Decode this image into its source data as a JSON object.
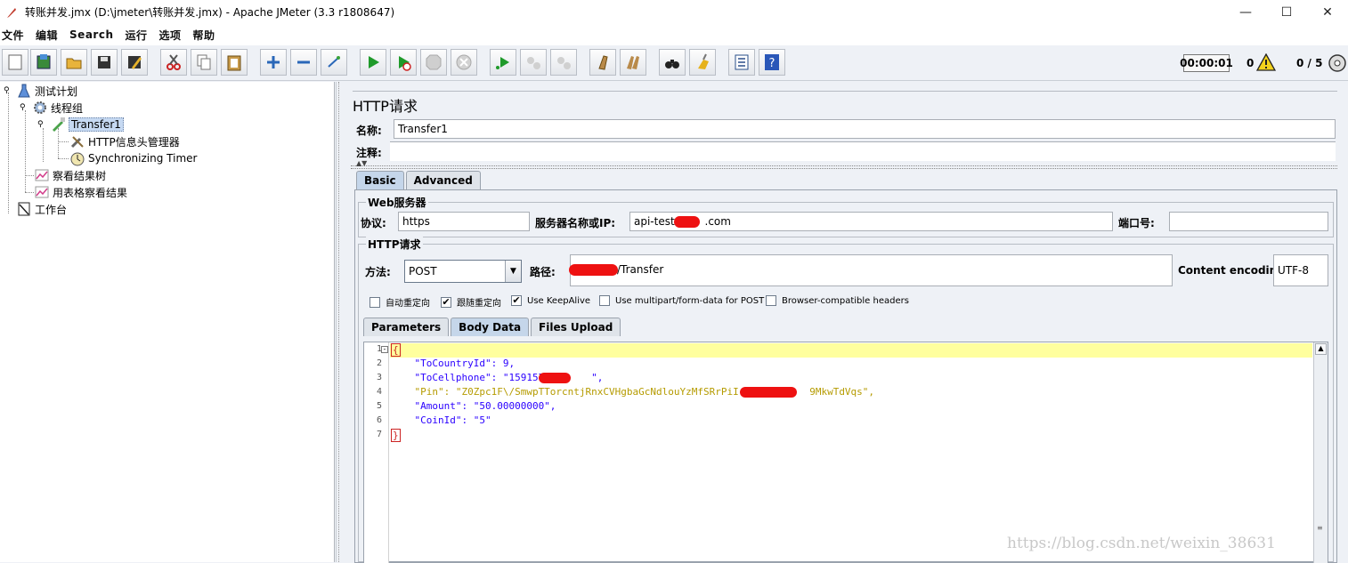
{
  "window": {
    "title": "转账并发.jmx (D:\\jmeter\\转账并发.jmx) - Apache JMeter (3.3 r1808647)",
    "minimize": "—",
    "maximize": "☐",
    "close": "✕"
  },
  "menu": [
    "文件",
    "编辑",
    "Search",
    "运行",
    "选项",
    "帮助"
  ],
  "status": {
    "timer": "00:00:01",
    "errors": "0",
    "threads": "0 / 5"
  },
  "tree": {
    "items": [
      {
        "label": "测试计划",
        "icon": "beaker-icon"
      },
      {
        "label": "线程组",
        "icon": "gear-icon"
      },
      {
        "label": "Transfer1",
        "icon": "pipette-icon"
      },
      {
        "label": "HTTP信息头管理器",
        "icon": "wrench-icon"
      },
      {
        "label": "Synchronizing Timer",
        "icon": "stopwatch-icon"
      },
      {
        "label": "察看结果树",
        "icon": "chart-icon"
      },
      {
        "label": "用表格察看结果",
        "icon": "chart-icon"
      },
      {
        "label": "工作台",
        "icon": "workbench-icon"
      }
    ]
  },
  "panel": {
    "title": "HTTP请求",
    "name_label": "名称:",
    "name_value": "Transfer1",
    "comment_label": "注释:",
    "comment_value": "",
    "tabs": [
      "Basic",
      "Advanced"
    ],
    "web_server": {
      "legend": "Web服务器",
      "protocol_label": "协议:",
      "protocol_value": "https",
      "server_label": "服务器名称或IP:",
      "server_value_prefix": "api-test.",
      "server_value_suffix": ".com",
      "port_label": "端口号:",
      "port_value": ""
    },
    "http_request": {
      "legend": "HTTP请求",
      "method_label": "方法:",
      "method_value": "POST",
      "path_label": "路径:",
      "path_value": "/Transfer",
      "encoding_label": "Content encoding:",
      "encoding_value": "UTF-8"
    },
    "checkboxes": [
      {
        "label": "自动重定向",
        "checked": false
      },
      {
        "label": "跟随重定向",
        "checked": true
      },
      {
        "label": "Use KeepAlive",
        "checked": true
      },
      {
        "label": "Use multipart/form-data for POST",
        "checked": false
      },
      {
        "label": "Browser-compatible headers",
        "checked": false
      }
    ],
    "subtabs": [
      "Parameters",
      "Body Data",
      "Files Upload"
    ],
    "body_lines": [
      {
        "n": "1",
        "text": "{"
      },
      {
        "n": "2",
        "text": "    \"ToCountryId\": 9,"
      },
      {
        "n": "3",
        "text": "    \"ToCellphone\": \"1591575       \","
      },
      {
        "n": "4",
        "text": "    \"Pin\": \"Z0Zpc1F\\/SmwpTTorcntjRnxCVHgbaGcNdlouYzMfSRrPiI            9MkwTdVqs\","
      },
      {
        "n": "5",
        "text": "    \"Amount\": \"50.00000000\","
      },
      {
        "n": "6",
        "text": "    \"CoinId\": \"5\""
      },
      {
        "n": "7",
        "text": "}"
      }
    ]
  },
  "watermark": "https://blog.csdn.net/weixin_38631"
}
